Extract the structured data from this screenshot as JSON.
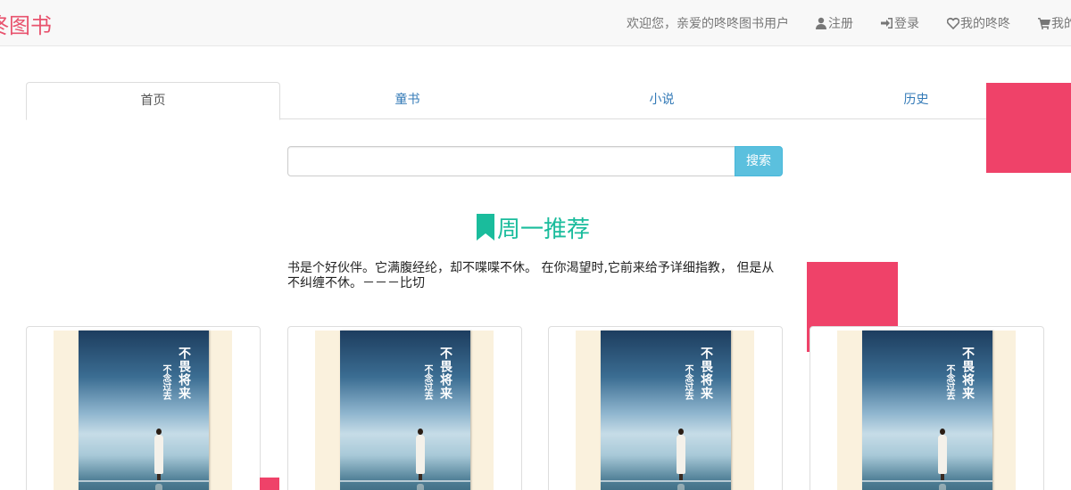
{
  "brand": {
    "name": "咚图书"
  },
  "nav": {
    "welcome": "欢迎您，亲爱的咚咚图书用户",
    "links": [
      {
        "label": "注册",
        "icon": "user-icon"
      },
      {
        "label": "登录",
        "icon": "login-icon"
      },
      {
        "label": "我的咚咚",
        "icon": "heart-icon"
      },
      {
        "label": "我的",
        "icon": "cart-icon"
      }
    ]
  },
  "tabs": [
    {
      "label": "首页",
      "active": true
    },
    {
      "label": "童书",
      "active": false
    },
    {
      "label": "小说",
      "active": false
    },
    {
      "label": "历史",
      "active": false
    }
  ],
  "search": {
    "value": "",
    "placeholder": "",
    "button_label": "搜索"
  },
  "section": {
    "title": "周一推荐",
    "icon": "bookmark-icon",
    "quote": "书是个好伙伴。它满腹经纶，却不喋喋不休。 在你渴望时,它前来给予详细指教， 但是从不纠缠不休。－－－比切"
  },
  "books": [
    {
      "cover_title": "不畏将来",
      "cover_title2": "不念过去"
    },
    {
      "cover_title": "不畏将来",
      "cover_title2": "不念过去"
    },
    {
      "cover_title": "不畏将来",
      "cover_title2": "不念过去"
    },
    {
      "cover_title": "不畏将来",
      "cover_title2": "不念过去"
    }
  ],
  "colors": {
    "brand": "#e8536e",
    "accent_teal": "#1abc9c",
    "search_button": "#5bc0de",
    "decor_pink": "#ef4269",
    "link": "#337ab7"
  }
}
